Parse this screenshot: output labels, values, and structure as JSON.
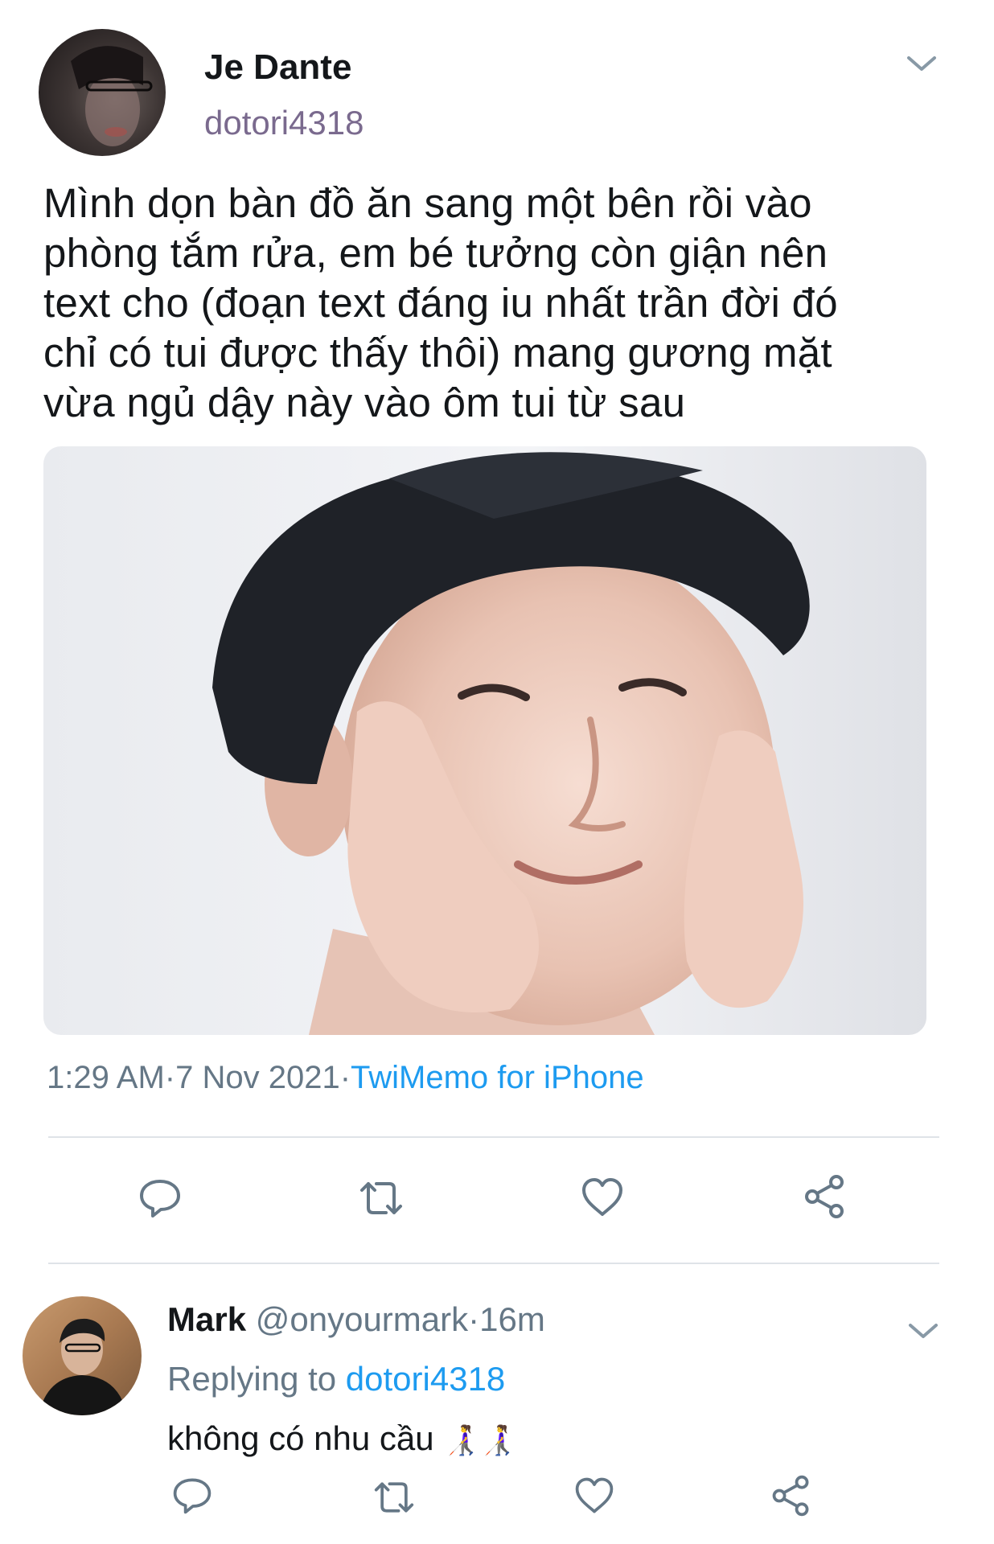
{
  "tweet": {
    "author_name": "Je Dante",
    "author_handle": "dotori4318",
    "text": "Mình dọn bàn đồ ăn sang một bên rồi vào\nphòng tắm rửa, em bé tưởng còn giận nên\ntext cho (đoạn text đáng iu nhất trần đời đó\nchỉ có tui được thấy thôi) mang gương mặt\nvừa ngủ dậy này vào ôm tui từ sau",
    "time": "1:29 AM",
    "separator": "·",
    "date": "7 Nov 2021",
    "source": "TwiMemo for iPhone",
    "actions": [
      "reply-icon",
      "retweet-icon",
      "like-icon",
      "share-icon"
    ]
  },
  "reply": {
    "author_name": "Mark",
    "author_handle": "@onyourmark",
    "separator": "·",
    "age": "16m",
    "replying_prefix": "Replying to",
    "replying_target": "dotori4318",
    "text": "không có nhu cầu",
    "emoji": "👩‍🦯👩‍🦯",
    "actions": [
      "reply-icon",
      "retweet-icon",
      "like-icon",
      "share-icon"
    ]
  },
  "colors": {
    "link": "#1d9bf0",
    "muted": "#657786",
    "handle": "#7a6a8e",
    "divider": "#dfe3e8"
  }
}
